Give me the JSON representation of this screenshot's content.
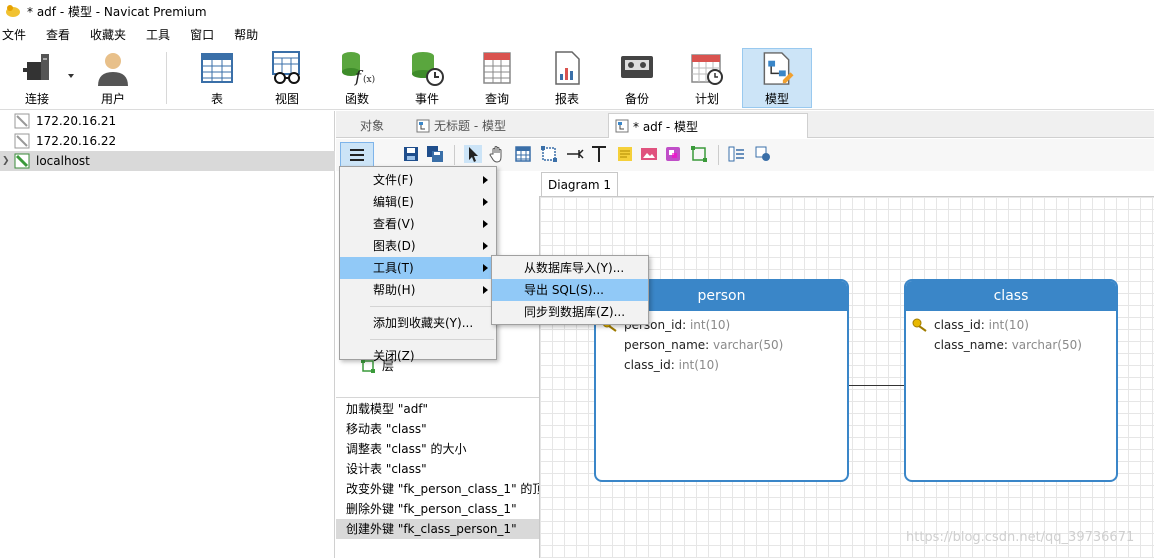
{
  "window": {
    "title": "* adf - 模型 - Navicat Premium"
  },
  "menubar": [
    "文件",
    "查看",
    "收藏夹",
    "工具",
    "窗口",
    "帮助"
  ],
  "toolbar": [
    {
      "label": "连接",
      "icon": "connection-icon"
    },
    {
      "label": "用户",
      "icon": "user-icon"
    },
    {
      "label": "表",
      "icon": "table-icon"
    },
    {
      "label": "视图",
      "icon": "view-icon"
    },
    {
      "label": "函数",
      "icon": "function-icon"
    },
    {
      "label": "事件",
      "icon": "event-icon"
    },
    {
      "label": "查询",
      "icon": "query-icon"
    },
    {
      "label": "报表",
      "icon": "report-icon"
    },
    {
      "label": "备份",
      "icon": "backup-icon"
    },
    {
      "label": "计划",
      "icon": "schedule-icon"
    },
    {
      "label": "模型",
      "icon": "model-icon"
    }
  ],
  "connections": [
    "172.20.16.21",
    "172.20.16.22",
    "localhost"
  ],
  "tabs": {
    "objects": "对象",
    "untitled": "无标题 - 模型",
    "current": "* adf - 模型"
  },
  "diagram_tab": "Diagram 1",
  "layer_label": "层",
  "main_menu": [
    {
      "label": "文件(F)",
      "submenu": true
    },
    {
      "label": "编辑(E)",
      "submenu": true
    },
    {
      "label": "查看(V)",
      "submenu": true
    },
    {
      "label": "图表(D)",
      "submenu": true
    },
    {
      "label": "工具(T)",
      "submenu": true
    },
    {
      "label": "帮助(H)",
      "submenu": true
    },
    {
      "label": "添加到收藏夹(Y)...",
      "submenu": false
    },
    {
      "label": "关闭(Z)",
      "submenu": false
    }
  ],
  "tools_submenu": [
    "从数据库导入(Y)...",
    "导出 SQL(S)...",
    "同步到数据库(Z)..."
  ],
  "history": [
    "加载模型 \"adf\"",
    "移动表 \"class\"",
    "调整表 \"class\" 的大小",
    "设计表 \"class\"",
    "改变外键 \"fk_person_class_1\" 的顶",
    "删除外键 \"fk_person_class_1\"",
    "创建外键 \"fk_class_person_1\""
  ],
  "entities": {
    "person": {
      "name": "person",
      "fields": [
        {
          "name": "person_id",
          "type": "int(10)"
        },
        {
          "name": "person_name",
          "type": "varchar(50)"
        },
        {
          "name": "class_id",
          "type": "int(10)"
        }
      ]
    },
    "class": {
      "name": "class",
      "fields": [
        {
          "name": "class_id",
          "type": "int(10)"
        },
        {
          "name": "class_name",
          "type": "varchar(50)"
        }
      ]
    }
  },
  "watermark": "https://blog.csdn.net/qq_39736671",
  "colors": {
    "accent": "#3a86c8",
    "highlight": "#91c9f7",
    "selected_bg": "#d9d9d9"
  }
}
